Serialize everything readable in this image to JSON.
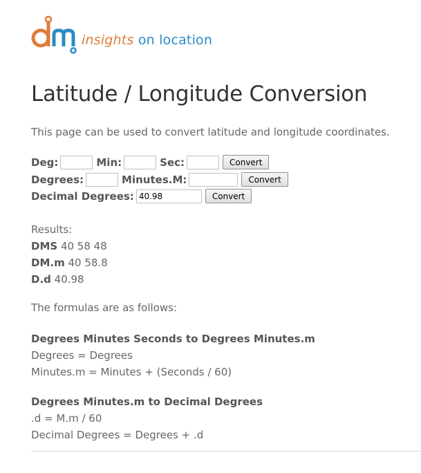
{
  "brand": {
    "logo_text": "dm",
    "tagline_insights": "insights",
    "tagline_on": "on",
    "tagline_location": "location",
    "colors": {
      "orange": "#e07b39",
      "blue": "#2b8cc4"
    }
  },
  "page": {
    "title": "Latitude / Longitude Conversion",
    "intro": "This page can be used to convert latitude and longitude coordinates."
  },
  "form": {
    "dms": {
      "deg_label": "Deg:",
      "min_label": "Min:",
      "sec_label": "Sec:",
      "deg_value": "",
      "min_value": "",
      "sec_value": "",
      "button": "Convert"
    },
    "dm": {
      "degrees_label": "Degrees:",
      "minutes_label": "Minutes.M:",
      "degrees_value": "",
      "minutes_value": "",
      "button": "Convert"
    },
    "dd": {
      "label": "Decimal Degrees:",
      "value": "40.98",
      "button": "Convert"
    }
  },
  "results": {
    "heading": "Results:",
    "dms_label": "DMS",
    "dms_value": " 40 58 48",
    "dm_label": "DM.m",
    "dm_value": " 40 58.8",
    "dd_label": "D.d",
    "dd_value": " 40.98"
  },
  "formulas": {
    "intro": "The formulas are as follows:",
    "block1": {
      "heading": "Degrees Minutes Seconds to Degrees Minutes.m",
      "line1": "Degrees = Degrees",
      "line2": "Minutes.m = Minutes + (Seconds / 60)"
    },
    "block2": {
      "heading": "Degrees Minutes.m to Decimal Degrees",
      "line1": ".d = M.m / 60",
      "line2": "Decimal Degrees = Degrees + .d"
    }
  }
}
